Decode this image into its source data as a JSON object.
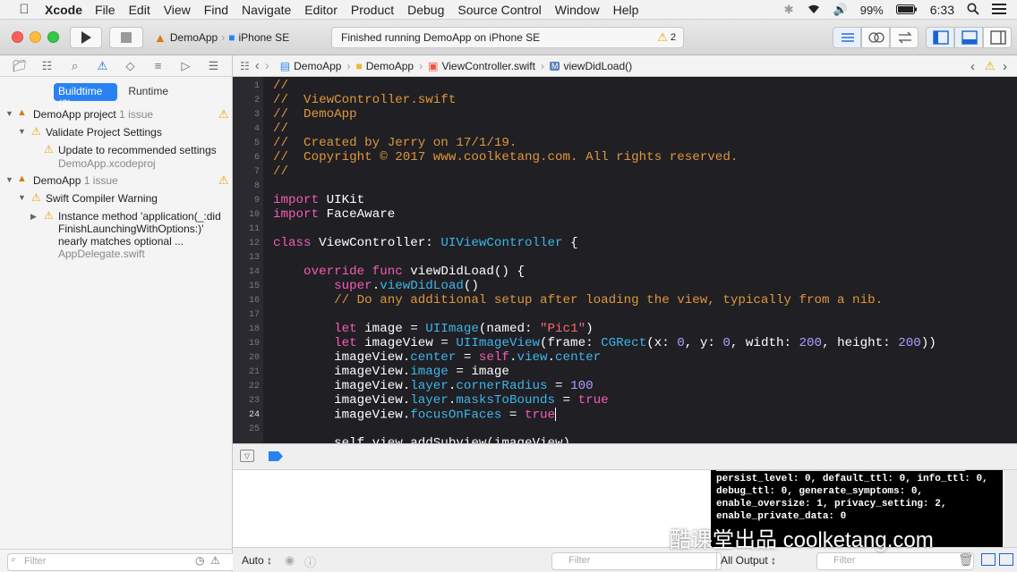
{
  "menubar": {
    "app": "Xcode",
    "items": [
      "File",
      "Edit",
      "View",
      "Find",
      "Navigate",
      "Editor",
      "Product",
      "Debug",
      "Source Control",
      "Window",
      "Help"
    ],
    "battery": "99%",
    "time": "6:33"
  },
  "toolbar": {
    "scheme": "DemoApp",
    "device": "iPhone SE",
    "activity": "Finished running DemoApp on iPhone SE",
    "warning_count": "2"
  },
  "navigator": {
    "seg_buildtime": "Buildtime (2)",
    "seg_runtime": "Runtime",
    "project_name": "DemoApp project",
    "project_issues": "1 issue",
    "validate": "Validate Project Settings",
    "update": "Update to recommended settings",
    "update_file": "DemoApp.xcodeproj",
    "target_name": "DemoApp",
    "target_issues": "1 issue",
    "compiler_warning": "Swift Compiler Warning",
    "issue_line1": "Instance method 'application(_:did",
    "issue_line2": "FinishLaunchingWithOptions:)'",
    "issue_line3": "nearly matches optional ...",
    "issue_file": "AppDelegate.swift",
    "filter_placeholder": "Filter"
  },
  "jumpbar": {
    "project": "DemoApp",
    "folder": "DemoApp",
    "file": "ViewController.swift",
    "symbol": "viewDidLoad()"
  },
  "code": {
    "lines": [
      "1",
      "2",
      "3",
      "4",
      "5",
      "6",
      "7",
      "8",
      "9",
      "10",
      "11",
      "12",
      "13",
      "14",
      "15",
      "16",
      "17",
      "18",
      "19",
      "20",
      "21",
      "22",
      "23",
      "24",
      "25"
    ],
    "l1": "//",
    "l2": "//  ViewController.swift",
    "l3": "//  DemoApp",
    "l4": "//",
    "l5": "//  Created by Jerry on 17/1/19.",
    "l6": "//  Copyright © 2017 www.coolketang.com. All rights reserved.",
    "l7": "//",
    "l9_kw": "import",
    "l9_rest": " UIKit",
    "l10_kw": "import",
    "l10_rest": " FaceAware",
    "l12_kw": "class",
    "l12_name": " ViewController: ",
    "l12_type": "UIViewController",
    "l12_end": " {",
    "l14_kw": "    override func",
    "l14_rest": " viewDidLoad() {",
    "l15_kw": "        super",
    "l15_dot": ".",
    "l15_fn": "viewDidLoad",
    "l15_end": "()",
    "l16": "        // Do any additional setup after loading the view, typically from a nib.",
    "l18_kw": "        let",
    "l18_a": " image = ",
    "l18_t": "UIImage",
    "l18_b": "(named: ",
    "l18_s": "\"Pic1\"",
    "l18_c": ")",
    "l19_kw": "        let",
    "l19_a": " imageView = ",
    "l19_t": "UIImageView",
    "l19_b": "(frame: ",
    "l19_t2": "CGRect",
    "l19_c": "(x: ",
    "l19_n1": "0",
    "l19_d": ", y: ",
    "l19_n2": "0",
    "l19_e": ", width: ",
    "l19_n3": "200",
    "l19_f": ", height: ",
    "l19_n4": "200",
    "l19_g": "))",
    "l20_a": "        imageView.",
    "l20_p": "center",
    "l20_b": " = ",
    "l20_kw": "self",
    "l20_c": ".",
    "l20_p2": "view",
    "l20_d": ".",
    "l20_p3": "center",
    "l21_a": "        imageView.",
    "l21_p": "image",
    "l21_b": " = image",
    "l22_a": "        imageView.",
    "l22_p": "layer",
    "l22_b": ".",
    "l22_p2": "cornerRadius",
    "l22_c": " = ",
    "l22_n": "100",
    "l23_a": "        imageView.",
    "l23_p": "layer",
    "l23_b": ".",
    "l23_p2": "masksToBounds",
    "l23_c": " = ",
    "l23_kw": "true",
    "l24_a": "        imageView.",
    "l24_p": "focusOnFaces",
    "l24_b": " = ",
    "l24_kw": "true",
    "l26": "        self.view.addSubview(imageView)"
  },
  "console": {
    "lines": [
      "persist_level: 0, default_ttl: 0, info_ttl: 0,",
      "debug_ttl: 0, generate_symptoms: 0,",
      "enable_oversize: 1, privacy_setting: 2,",
      "enable_private_data: 0"
    ]
  },
  "bottom": {
    "auto": "Auto",
    "filter": "Filter",
    "all_output": "All Output",
    "filter2": "Filter"
  },
  "watermark": "酷课堂出品 coolketang.com"
}
